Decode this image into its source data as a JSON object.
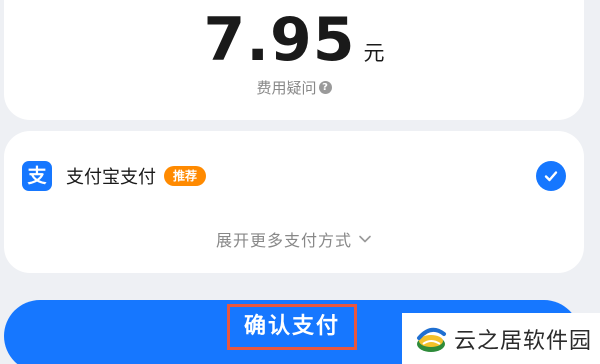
{
  "payment": {
    "amount": "7.95",
    "unit": "元",
    "fee_question": "费用疑问",
    "help_icon": "question-circle-icon"
  },
  "methods": {
    "selected": {
      "logo_char": "支",
      "logo_icon": "alipay-icon",
      "label": "支付宝支付",
      "badge": "推荐",
      "checked": true
    },
    "expand_label": "展开更多支付方式",
    "expand_icon": "chevron-down-icon"
  },
  "actions": {
    "confirm_label": "确认支付"
  },
  "watermark": {
    "text": "云之居软件园"
  },
  "colors": {
    "accent": "#1677ff",
    "badge": "#ff8a00",
    "highlight_box": "#e8573d",
    "background": "#eef0f4"
  }
}
